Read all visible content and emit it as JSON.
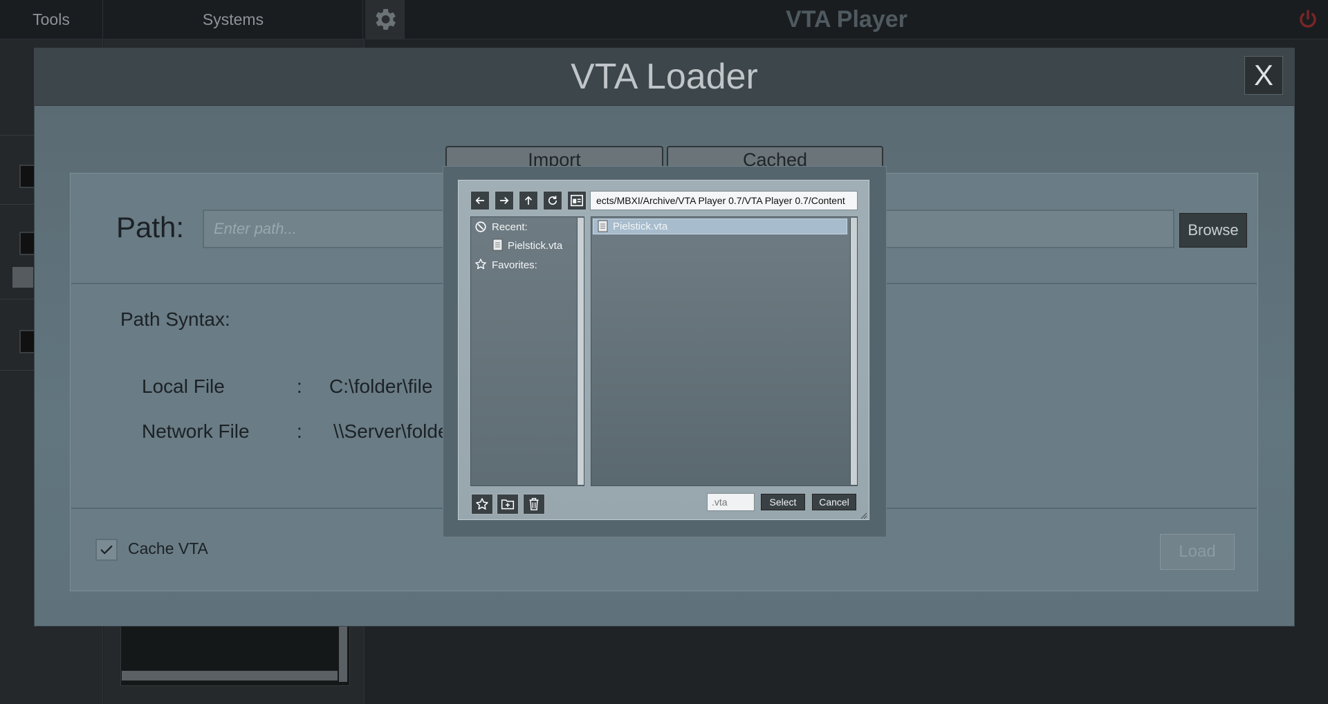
{
  "topbar": {
    "tools_label": "Tools",
    "systems_label": "Systems",
    "app_title": "VTA Player"
  },
  "loader": {
    "title": "VTA Loader",
    "close_label": "X",
    "tabs": [
      {
        "label": "Import"
      },
      {
        "label": "Cached"
      }
    ],
    "path_label": "Path:",
    "path_placeholder": "Enter path...",
    "browse_label": "Browse",
    "syntax_title": "Path Syntax:",
    "local_file_label": "Local File",
    "local_file_sep": ":",
    "local_file_value": "C:\\folder\\file",
    "network_file_label": "Network File",
    "network_file_sep": ":",
    "network_file_value": "\\\\Server\\folde",
    "cache_label": "Cache VTA",
    "cache_checked": true,
    "load_label": "Load"
  },
  "file_dialog": {
    "path": "ects/MBXI/Archive/VTA Player 0.7/VTA Player 0.7/Content",
    "recent_label": "Recent:",
    "recent_items": [
      "Pielstick.vta"
    ],
    "favorites_label": "Favorites:",
    "files": [
      "Pielstick.vta"
    ],
    "filter_placeholder": ".vta",
    "select_label": "Select",
    "cancel_label": "Cancel"
  },
  "colors": {
    "accent_selected_row": "#a7bccd",
    "dialog_panel": "#6a7c85",
    "power_icon": "#8a2a2a"
  }
}
